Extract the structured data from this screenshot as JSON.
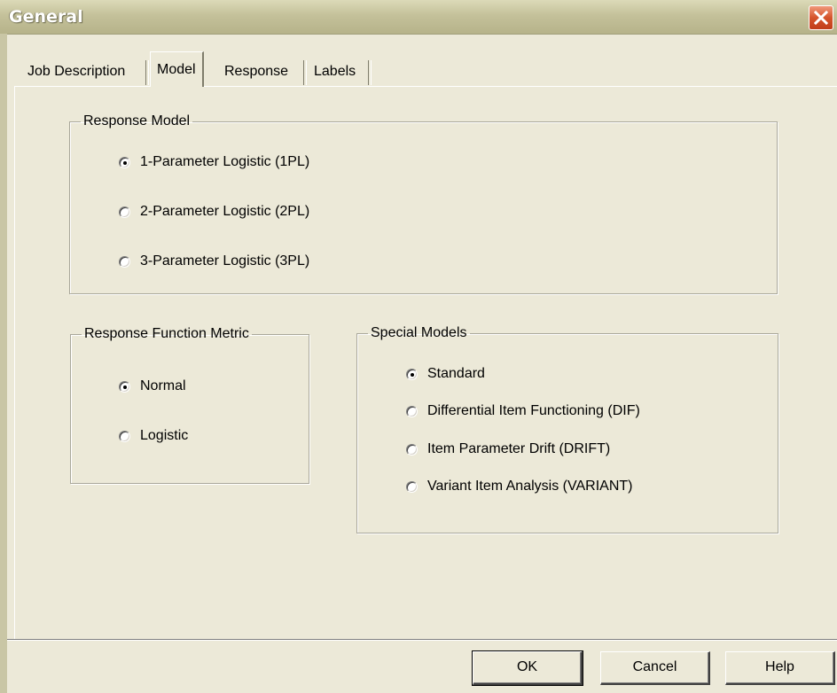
{
  "window": {
    "title": "General"
  },
  "tabs": [
    "Job Description",
    "Model",
    "Response",
    "Labels"
  ],
  "groups": {
    "response_model": {
      "title": "Response Model",
      "options": [
        "1-Parameter Logistic (1PL)",
        "2-Parameter Logistic (2PL)",
        "3-Parameter Logistic (3PL)"
      ],
      "selected": "1-Parameter Logistic (1PL)"
    },
    "response_function_metric": {
      "title": "Response Function Metric",
      "options": [
        "Normal",
        "Logistic"
      ],
      "selected": "Normal"
    },
    "special_models": {
      "title": "Special Models",
      "options": [
        "Standard",
        "Differential Item Functioning (DIF)",
        "Item Parameter Drift (DRIFT)",
        "Variant Item Analysis (VARIANT)"
      ],
      "selected": "Standard"
    }
  },
  "buttons": {
    "ok": "OK",
    "cancel": "Cancel",
    "help": "Help"
  }
}
